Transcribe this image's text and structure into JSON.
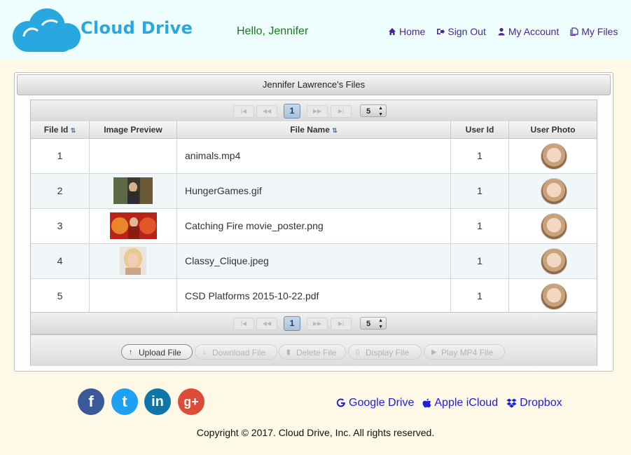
{
  "header": {
    "logo_text": "Cloud Drive",
    "greeting": "Hello, Jennifer",
    "nav": [
      {
        "label": "Home",
        "icon": "home-icon"
      },
      {
        "label": "Sign Out",
        "icon": "sign-out-icon"
      },
      {
        "label": "My Account",
        "icon": "user-icon"
      },
      {
        "label": "My Files",
        "icon": "files-icon"
      }
    ]
  },
  "panel": {
    "title": "Jennifer Lawrence's Files"
  },
  "pager": {
    "current_page": "1",
    "rows_per_page": "5"
  },
  "table": {
    "columns": [
      "File Id",
      "Image Preview",
      "File Name",
      "User Id",
      "User Photo"
    ],
    "rows": [
      {
        "id": "1",
        "file_name": "animals.mp4",
        "user_id": "1",
        "preview": "none"
      },
      {
        "id": "2",
        "file_name": "HungerGames.gif",
        "user_id": "1",
        "preview": "hunger-games-thumbnail"
      },
      {
        "id": "3",
        "file_name": "Catching Fire movie_poster.png",
        "user_id": "1",
        "preview": "catching-fire-poster-thumbnail"
      },
      {
        "id": "4",
        "file_name": "Classy_Clique.jpeg",
        "user_id": "1",
        "preview": "portrait-thumbnail"
      },
      {
        "id": "5",
        "file_name": "CSD Platforms 2015-10-22.pdf",
        "user_id": "1",
        "preview": "none"
      }
    ]
  },
  "toolbar": {
    "upload": "Upload File",
    "download": "Download File",
    "delete": "Delete File",
    "display": "Display File",
    "play": "Play MP4 File"
  },
  "footer": {
    "social": [
      {
        "label": "f",
        "name": "facebook-icon",
        "color": "#3b5998"
      },
      {
        "label": "t",
        "name": "twitter-icon",
        "color": "#1da1f2"
      },
      {
        "label": "in",
        "name": "linkedin-icon",
        "color": "#0e76a8"
      },
      {
        "label": "g+",
        "name": "google-plus-icon",
        "color": "#dd4b39"
      }
    ],
    "cloud_links": [
      {
        "label": "Google Drive",
        "icon": "google-icon"
      },
      {
        "label": "Apple iCloud",
        "icon": "apple-icon"
      },
      {
        "label": "Dropbox",
        "icon": "dropbox-icon"
      }
    ],
    "copyright": "Copyright © 2017. Cloud Drive, Inc. All rights reserved."
  },
  "colors": {
    "header_bg": "#eefdfe",
    "main_bg": "#fef8e6",
    "logo": "#29a8e0",
    "nav": "#4b2596",
    "greeting": "#1a7a1a",
    "link": "#1d1ddb"
  }
}
